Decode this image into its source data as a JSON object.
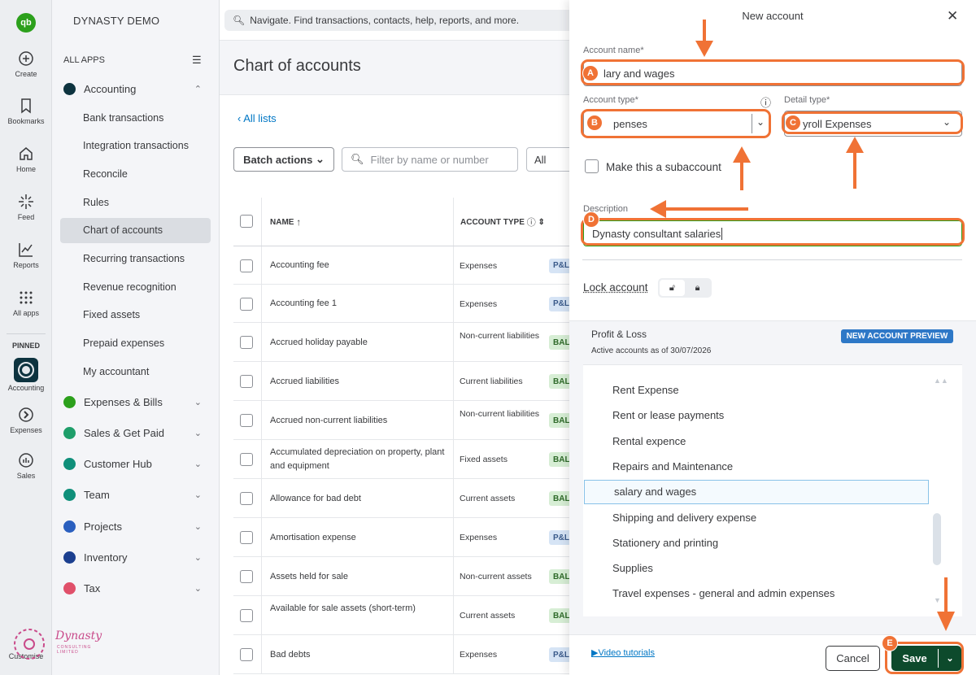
{
  "rail": {
    "logo": "qb",
    "items": [
      {
        "label": "Create",
        "icon": "plus-circle-icon"
      },
      {
        "label": "Bookmarks",
        "icon": "bookmark-icon"
      },
      {
        "label": "Home",
        "icon": "home-icon"
      },
      {
        "label": "Feed",
        "icon": "sparkle-icon"
      },
      {
        "label": "Reports",
        "icon": "line-chart-icon"
      },
      {
        "label": "All apps",
        "icon": "grid-icon"
      }
    ],
    "pinned_label": "PINNED",
    "pinned": [
      {
        "label": "Accounting",
        "icon": "accounting-icon"
      },
      {
        "label": "Expenses",
        "icon": "expenses-icon"
      },
      {
        "label": "Sales",
        "icon": "sales-icon"
      }
    ],
    "customise": "Customise"
  },
  "company": "DYNASTY DEMO",
  "apps": {
    "header": "ALL APPS",
    "accounting": "Accounting",
    "accounting_sub": [
      "Bank transactions",
      "Integration transactions",
      "Reconcile",
      "Rules",
      "Chart of accounts",
      "Recurring transactions",
      "Revenue recognition",
      "Fixed assets",
      "Prepaid expenses",
      "My accountant"
    ],
    "others": [
      {
        "label": "Expenses & Bills",
        "color": "#2ca01c"
      },
      {
        "label": "Sales & Get Paid",
        "color": "#1e9e6a"
      },
      {
        "label": "Customer Hub",
        "color": "#0f8f7a"
      },
      {
        "label": "Team",
        "color": "#0f8f7a"
      },
      {
        "label": "Projects",
        "color": "#2a5fbf"
      },
      {
        "label": "Inventory",
        "color": "#1b3f8f"
      },
      {
        "label": "Tax",
        "color": "#e0506a"
      }
    ]
  },
  "search": {
    "placeholder": "Navigate. Find transactions, contacts, help, reports, and more."
  },
  "main": {
    "title": "Chart of accounts",
    "all_lists": "All lists",
    "batch_actions": "Batch actions",
    "filter_placeholder": "Filter by name or number",
    "filter_all": "All",
    "col_name": "NAME",
    "col_type": "ACCOUNT TYPE",
    "rows": [
      {
        "name": "Accounting fee",
        "type": "Expenses",
        "tag": "P&L"
      },
      {
        "name": "Accounting fee 1",
        "type": "Expenses",
        "tag": "P&L"
      },
      {
        "name": "Accrued holiday payable",
        "type": "Non-current liabilities",
        "tag": "BAL"
      },
      {
        "name": "Accrued liabilities",
        "type": "Current liabilities",
        "tag": "BAL"
      },
      {
        "name": "Accrued non-current liabilities",
        "type": "Non-current liabilities",
        "tag": "BAL"
      },
      {
        "name": "Accumulated depreciation on property, plant and equipment",
        "type": "Fixed assets",
        "tag": "BAL"
      },
      {
        "name": "Allowance for bad debt",
        "type": "Current assets",
        "tag": "BAL"
      },
      {
        "name": "Amortisation expense",
        "type": "Expenses",
        "tag": "P&L"
      },
      {
        "name": "Assets held for sale",
        "type": "Non-current assets",
        "tag": "BAL"
      },
      {
        "name": "Available for sale assets (short-term)",
        "type": "Current assets",
        "tag": "BAL"
      },
      {
        "name": "Bad debts",
        "type": "Expenses",
        "tag": "P&L"
      }
    ]
  },
  "drawer": {
    "title": "New account",
    "account_name_label": "Account name*",
    "account_name_value": "lary and wages",
    "account_type_label": "Account type*",
    "account_type_value": "penses",
    "detail_type_label": "Detail type*",
    "detail_type_value": "yroll Expenses",
    "subaccount_label": "Make this a subaccount",
    "description_label": "Description",
    "description_value": "Dynasty consultant salaries",
    "lock_label": "Lock account",
    "pl_title": "Profit & Loss",
    "pl_sub": "Active accounts as of 30/07/2026",
    "preview_badge": "NEW ACCOUNT PREVIEW",
    "accounts": [
      "Rent Expense",
      "Rent or lease payments",
      "Rental expence",
      "Repairs and Maintenance",
      "salary and wages",
      "Shipping and delivery expense",
      "Stationery and printing",
      "Supplies",
      "Travel expenses - general and admin expenses"
    ],
    "video_tutorials": "Video tutorials",
    "cancel": "Cancel",
    "save": "Save"
  },
  "callouts": [
    "A",
    "B",
    "C",
    "D",
    "E"
  ],
  "colors": {
    "callout": "#f07235",
    "save": "#0d4a2c",
    "link": "#0077c5"
  },
  "watermark": {
    "name": "Dynasty",
    "sub": "CONSULTING LIMITED"
  }
}
